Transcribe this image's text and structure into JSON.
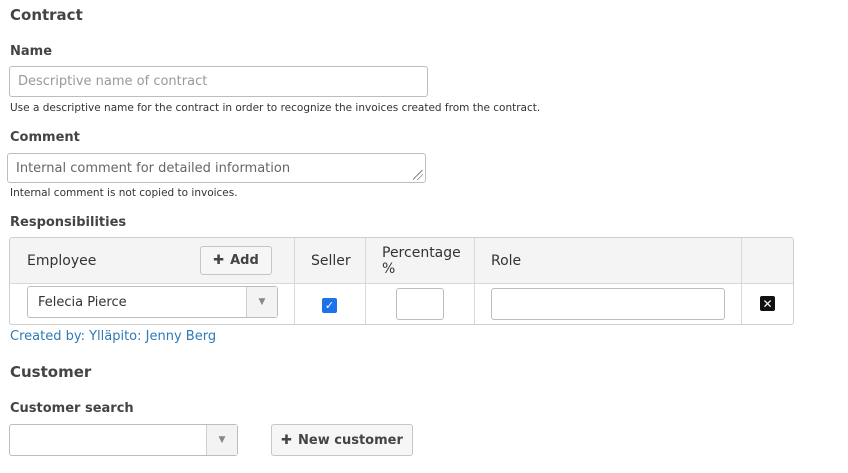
{
  "contract": {
    "title": "Contract",
    "name": {
      "label": "Name",
      "placeholder": "Descriptive name of contract",
      "help": "Use a descriptive name for the contract in order to recognize the invoices created from the contract."
    },
    "comment": {
      "label": "Comment",
      "placeholder": "Internal comment for detailed information",
      "help": "Internal comment is not copied to invoices."
    }
  },
  "responsibilities": {
    "label": "Responsibilities",
    "headers": {
      "employee": "Employee",
      "add_button": "Add",
      "seller": "Seller",
      "percentage": "Percentage %",
      "role": "Role"
    },
    "rows": [
      {
        "employee": "Felecia Pierce",
        "seller_checked": true,
        "percentage": "",
        "role": ""
      }
    ],
    "created_by": "Created by: Ylläpito: Jenny Berg"
  },
  "customer": {
    "title": "Customer",
    "search_label": "Customer search",
    "search_value": "",
    "new_customer_button": "New customer"
  },
  "icons": {
    "plus": "plus-icon",
    "dropdown": "chevron-down-icon",
    "check": "checkmark-icon",
    "remove": "close-box-icon"
  }
}
